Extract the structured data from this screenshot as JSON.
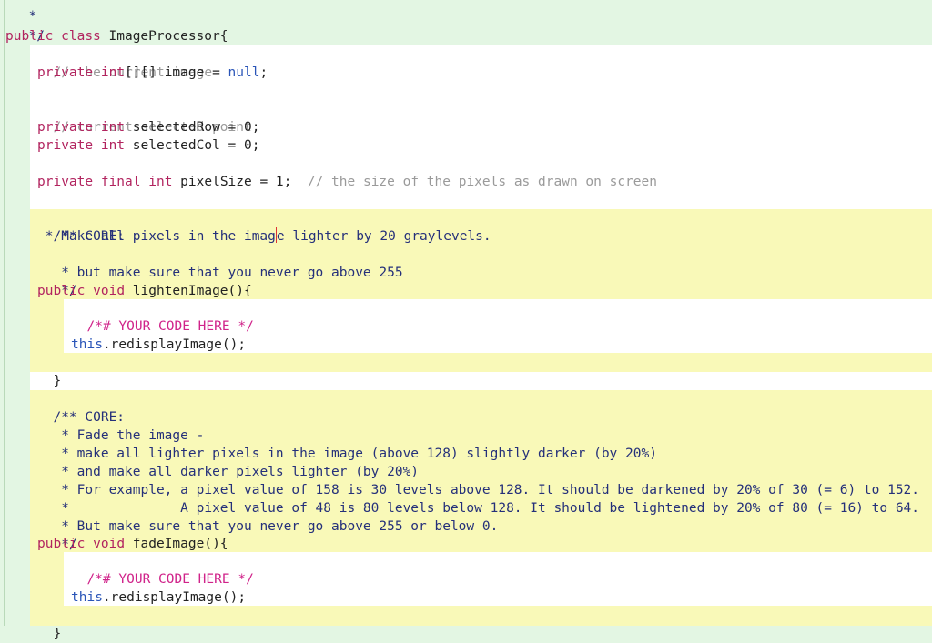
{
  "code": {
    "star_fragment": "*",
    "close_comment": "*/",
    "kw_public": "public",
    "kw_class": "class",
    "kw_private": "private",
    "kw_int": "int",
    "kw_final": "final",
    "kw_void": "void",
    "kw_this": "this",
    "lit_null": "null",
    "class_name": "ImageProcessor{",
    "comment_current_image": "// the current image",
    "image_decl_type_suffix": "[][]",
    "image_decl_rest": " image = ",
    "semicolon": ";",
    "comment_selected_point": "// current selected point",
    "selected_row_decl": " selectedRow = 0;",
    "selected_col_decl": " selectedCol = 0;",
    "pixel_size_decl": " pixelSize = 1;",
    "comment_pixel_size": "// the size of the pixels as drawn on screen",
    "lighten_doc": [
      "/** CORE:",
      " * Make all pixels in the imag",
      "e lighter by 20 graylevels.",
      " * but make sure that you never go above 255",
      " */"
    ],
    "lighten_signature": " lightenImage(){",
    "placeholder": "/*# YOUR CODE HERE */",
    "redisplay_call": ".redisplayImage();",
    "close_brace": "}",
    "fade_doc": [
      "/** CORE:",
      " * Fade the image -",
      " * make all lighter pixels in the image (above 128) slightly darker (by 20%)",
      " * and make all darker pixels lighter (by 20%)",
      " * For example, a pixel value of 158 is 30 levels above 128. It should be darkened by 20% of 30 (= 6) to 152.",
      " *              A pixel value of 48 is 80 levels below 128. It should be lightened by 20% of 80 (= 16) to 64.",
      " * But make sure that you never go above 255 or below 0.",
      " */"
    ],
    "fade_signature": " fadeImage(){"
  },
  "colors": {
    "editor_background": "#e3f6e3",
    "method_block": "#f9f9b8",
    "method_body": "#ffffff",
    "class_body": "#ffffff",
    "keyword": "#b2245f",
    "literal": "#2a55b8",
    "comment": "#9a9a9a",
    "doc_comment": "#25307a",
    "placeholder": "#d0238a"
  }
}
